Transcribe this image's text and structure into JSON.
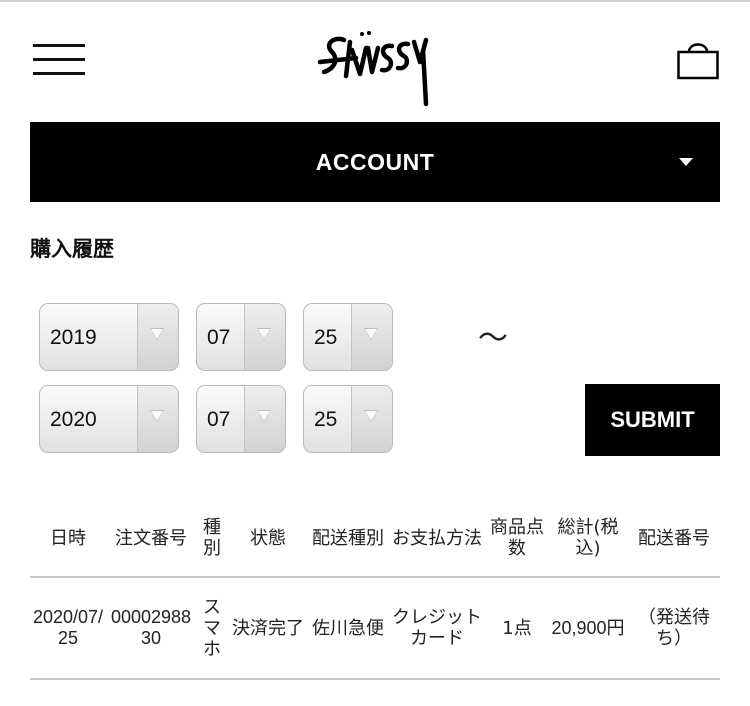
{
  "header": {
    "menu_icon": "hamburger-menu-icon",
    "logo_text": "Stussy",
    "cart_icon": "shopping-bag-icon"
  },
  "account_bar": {
    "label": "ACCOUNT",
    "icon": "caret-down-icon"
  },
  "page_title": "購入履歴",
  "date_filter": {
    "from": {
      "year": "2019",
      "month": "07",
      "day": "25"
    },
    "to": {
      "year": "2020",
      "month": "07",
      "day": "25"
    },
    "separator": "〜",
    "submit_label": "SUBMIT"
  },
  "orders_table": {
    "headers": [
      "日時",
      "注文番号",
      "種別",
      "状態",
      "配送種別",
      "お支払方法",
      "商品点数",
      "総計(税込)",
      "配送番号"
    ],
    "rows": [
      {
        "date": "2020/07/25",
        "order_number": "0000298830",
        "type": "スマホ",
        "status": "決済完了",
        "shipping_method": "佐川急便",
        "payment_method": "クレジットカード",
        "item_count": "1点",
        "total": "20,900円",
        "tracking": "（発送待ち）"
      }
    ]
  },
  "colors": {
    "accent": "#000000",
    "background": "#ffffff",
    "divider": "#c8c8c8"
  }
}
